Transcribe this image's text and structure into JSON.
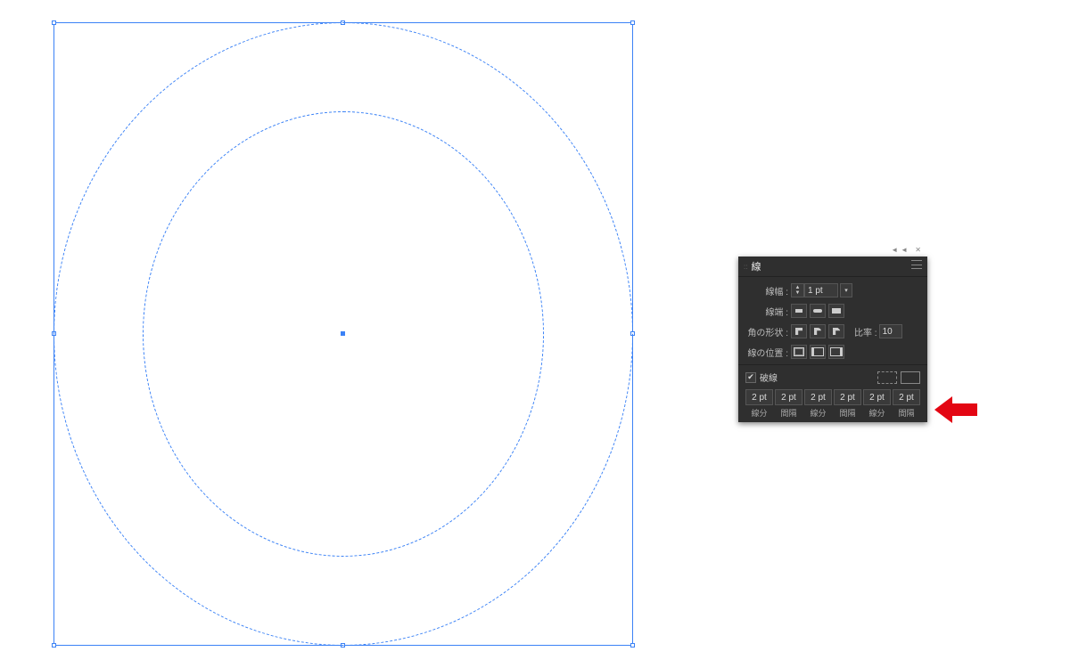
{
  "panel": {
    "title": "線",
    "weight_label": "線幅 :",
    "weight_value": "1 pt",
    "cap_label": "線端 :",
    "corner_label": "角の形状 :",
    "limit_label": "比率 :",
    "limit_value": "10",
    "align_label": "線の位置 :",
    "dash_label": "破線",
    "dash_checked": true,
    "dash_values": [
      "2 pt",
      "2 pt",
      "2 pt",
      "2 pt",
      "2 pt",
      "2 pt"
    ],
    "dash_col_labels": [
      "線分",
      "間隔",
      "線分",
      "間隔",
      "線分",
      "間隔"
    ]
  }
}
